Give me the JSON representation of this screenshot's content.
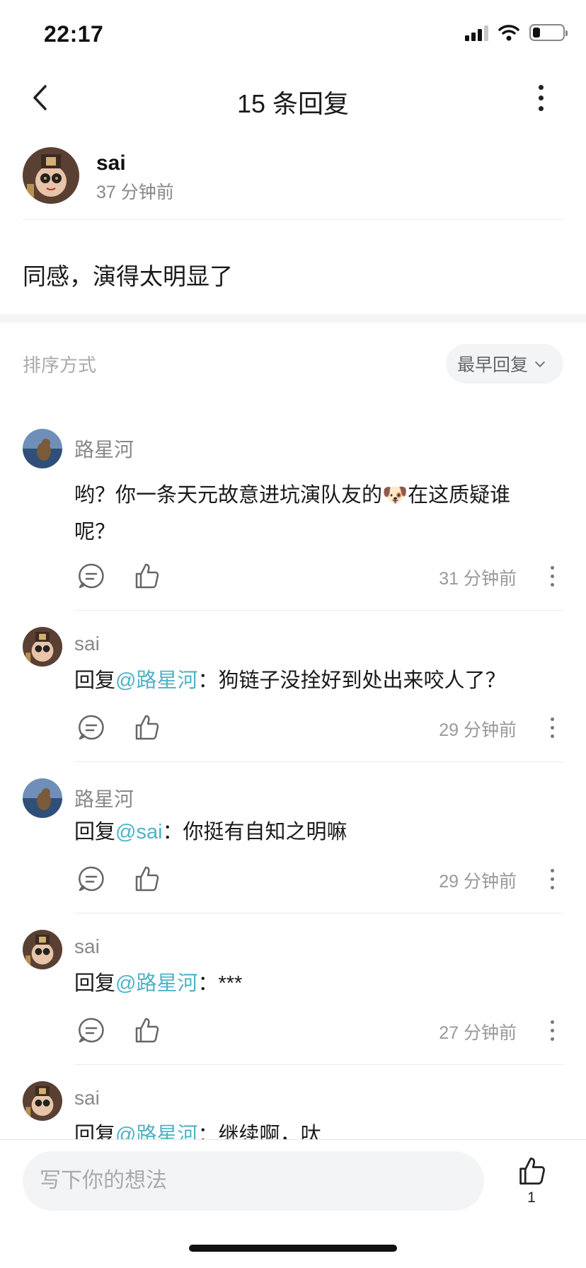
{
  "status_bar": {
    "time": "22:17",
    "battery_level": 0.25
  },
  "nav": {
    "title": "15 条回复"
  },
  "origin": {
    "username": "sai",
    "time": "37 分钟前",
    "content": "同感，演得太明显了"
  },
  "sort": {
    "label": "排序方式",
    "selected": "最早回复"
  },
  "replies": [
    {
      "username": "路星河",
      "avatar": "dog-avatar",
      "text_before": "哟？你一条天元故意进坑演队友的",
      "emoji": "🐶",
      "text_after": "在这质疑谁呢？",
      "time": "31 分钟前"
    },
    {
      "username": "sai",
      "avatar": "doll-avatar",
      "reply_prefix": "回复",
      "mention": "@路星河",
      "separator": "：",
      "text": "狗链子没拴好到处出来咬人了？",
      "time": "29 分钟前"
    },
    {
      "username": "路星河",
      "avatar": "dog-avatar",
      "reply_prefix": "回复",
      "mention": "@sai",
      "separator": "：",
      "text": "你挺有自知之明嘛",
      "time": "29 分钟前"
    },
    {
      "username": "sai",
      "avatar": "doll-avatar",
      "reply_prefix": "回复",
      "mention": "@路星河",
      "separator": "：",
      "text": "***",
      "time": "27 分钟前"
    },
    {
      "username": "sai",
      "avatar": "doll-avatar",
      "reply_prefix": "回复",
      "mention": "@路星河",
      "separator": "：",
      "text": "继续啊，呔"
    }
  ],
  "bottom_bar": {
    "input_placeholder": "写下你的想法",
    "like_count": "1"
  },
  "colors": {
    "mention": "#4fb3c4",
    "muted": "#999999"
  }
}
